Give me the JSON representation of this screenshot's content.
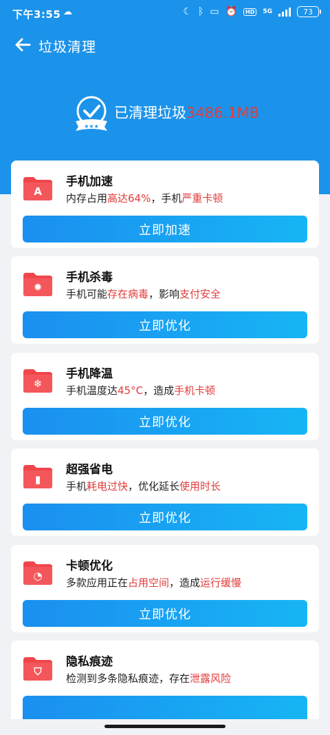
{
  "status_bar": {
    "time": "下午3:55",
    "network": "5G",
    "hd": "HD",
    "battery": "73"
  },
  "header": {
    "title": "垃圾清理"
  },
  "hero": {
    "label": "已清理垃圾",
    "amount": "3486.1MB"
  },
  "colors": {
    "primary": "#1c93ea",
    "highlight": "#e23b3b",
    "icon_red": "#f0464b",
    "button_start": "#1a8ff0",
    "button_end": "#17b5f4"
  },
  "cards": [
    {
      "icon": "rocket-folder-icon",
      "title": "手机加速",
      "desc": [
        {
          "t": "内存占用",
          "hl": false
        },
        {
          "t": "高达64%",
          "hl": true
        },
        {
          "t": "，手机",
          "hl": false
        },
        {
          "t": "严重卡顿",
          "hl": true
        }
      ],
      "button": "立即加速"
    },
    {
      "icon": "virus-folder-icon",
      "title": "手机杀毒",
      "desc": [
        {
          "t": "手机可能",
          "hl": false
        },
        {
          "t": "存在病毒",
          "hl": true
        },
        {
          "t": "，影响",
          "hl": false
        },
        {
          "t": "支付安全",
          "hl": true
        }
      ],
      "button": "立即优化"
    },
    {
      "icon": "snowflake-folder-icon",
      "title": "手机降温",
      "desc": [
        {
          "t": "手机温度达",
          "hl": false
        },
        {
          "t": "45°C",
          "hl": true
        },
        {
          "t": "，造成",
          "hl": false
        },
        {
          "t": "手机卡顿",
          "hl": true
        }
      ],
      "button": "立即优化"
    },
    {
      "icon": "battery-folder-icon",
      "title": "超强省电",
      "desc": [
        {
          "t": "手机",
          "hl": false
        },
        {
          "t": "耗电过快",
          "hl": true
        },
        {
          "t": "，优化延长",
          "hl": false
        },
        {
          "t": "使用时长",
          "hl": true
        }
      ],
      "button": "立即优化"
    },
    {
      "icon": "speedometer-folder-icon",
      "title": "卡顿优化",
      "desc": [
        {
          "t": "多款应用正在",
          "hl": false
        },
        {
          "t": "占用空间",
          "hl": true
        },
        {
          "t": "，造成",
          "hl": false
        },
        {
          "t": "运行缓慢",
          "hl": true
        }
      ],
      "button": "立即优化"
    },
    {
      "icon": "shield-folder-icon",
      "title": "隐私痕迹",
      "desc": [
        {
          "t": "检测到多条隐私痕迹，存在",
          "hl": false
        },
        {
          "t": "泄露风险",
          "hl": true
        }
      ],
      "button": ""
    }
  ]
}
